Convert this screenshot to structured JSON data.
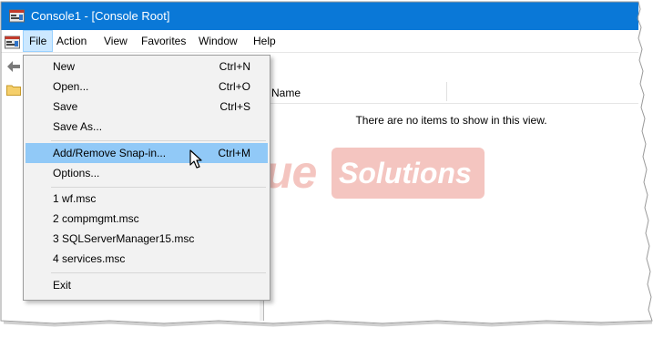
{
  "window": {
    "title": "Console1 - [Console Root]"
  },
  "menubar": {
    "items": [
      "File",
      "Action",
      "View",
      "Favorites",
      "Window",
      "Help"
    ],
    "active": "File"
  },
  "file_menu": {
    "groups": [
      [
        {
          "label": "New",
          "shortcut": "Ctrl+N"
        },
        {
          "label": "Open...",
          "shortcut": "Ctrl+O"
        },
        {
          "label": "Save",
          "shortcut": "Ctrl+S"
        },
        {
          "label": "Save As...",
          "shortcut": ""
        }
      ],
      [
        {
          "label": "Add/Remove Snap-in...",
          "shortcut": "Ctrl+M",
          "highlighted": true
        },
        {
          "label": "Options...",
          "shortcut": ""
        }
      ],
      [
        {
          "label": "1 wf.msc",
          "shortcut": ""
        },
        {
          "label": "2 compmgmt.msc",
          "shortcut": ""
        },
        {
          "label": "3 SQLServerManager15.msc",
          "shortcut": ""
        },
        {
          "label": "4 services.msc",
          "shortcut": ""
        }
      ],
      [
        {
          "label": "Exit",
          "shortcut": ""
        }
      ]
    ]
  },
  "list_view": {
    "column_name": "Name",
    "empty_message": "There are no items to show in this view."
  },
  "watermark": {
    "part1": "PCVue",
    "part2": "Solutions"
  },
  "colors": {
    "titlebar": "#0a78d7",
    "menu_highlight": "#91c9f7",
    "watermark": "#d9331f"
  },
  "icons": [
    "mmc-console-icon",
    "back-arrow-icon",
    "folder-icon",
    "mouse-pointer-icon"
  ]
}
